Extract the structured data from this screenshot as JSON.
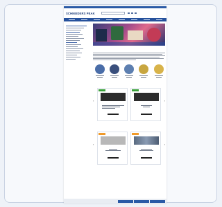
{
  "header": {
    "logo": "SCHNEIDERS PEAK"
  },
  "hero": {
    "image": "hero-banner"
  },
  "colors": {
    "brand": "#26519c",
    "accent_green": "#3aa03a",
    "accent_orange": "#f09a2a"
  },
  "featured_circles": [
    {
      "color": "#4a6da8"
    },
    {
      "color": "#3a4f7c"
    },
    {
      "color": "#5d7fb0"
    },
    {
      "color": "#c8a640"
    },
    {
      "color": "#d8b34a"
    }
  ],
  "products_row1": [
    {
      "badge": "green",
      "image": "dark"
    },
    {
      "badge": "green",
      "image": "dark"
    }
  ],
  "products_row2": [
    {
      "badge": "orange",
      "image": "light"
    },
    {
      "badge": "orange",
      "image": "steel"
    }
  ]
}
